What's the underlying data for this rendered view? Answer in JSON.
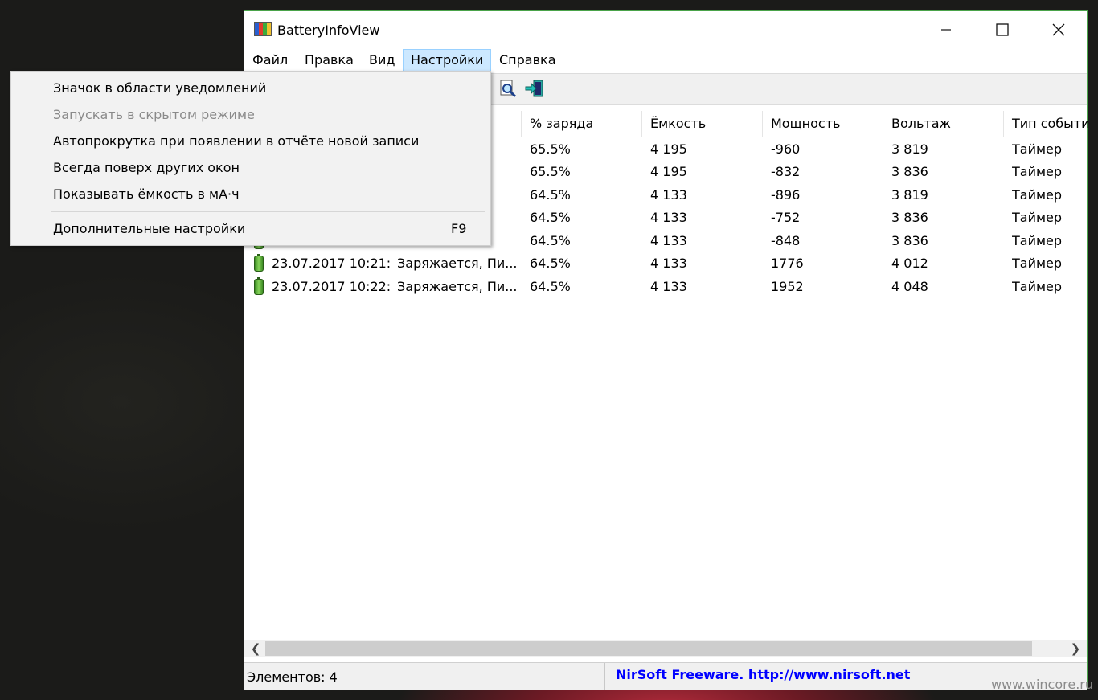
{
  "window": {
    "title": "BatteryInfoView"
  },
  "menubar": [
    "Файл",
    "Правка",
    "Вид",
    "Настройки",
    "Справка"
  ],
  "columns": [
    "",
    "",
    "% заряда",
    "Ёмкость",
    "Мощность",
    "Вольтаж",
    "Тип событи"
  ],
  "rows": [
    [
      "",
      "",
      "65.5%",
      "4 195",
      "-960",
      "3 819",
      "Таймер"
    ],
    [
      "",
      "",
      "65.5%",
      "4 195",
      "-832",
      "3 836",
      "Таймер"
    ],
    [
      "",
      "",
      "64.5%",
      "4 133",
      "-896",
      "3 819",
      "Таймер"
    ],
    [
      "",
      "",
      "64.5%",
      "4 133",
      "-752",
      "3 836",
      "Таймер"
    ],
    [
      "",
      "",
      "64.5%",
      "4 133",
      "-848",
      "3 836",
      "Таймер"
    ],
    [
      "23.07.2017 10:21:...",
      "Заряжается, Пи...",
      "64.5%",
      "4 133",
      "1776",
      "4 012",
      "Таймер"
    ],
    [
      "23.07.2017 10:22:...",
      "Заряжается, Пи...",
      "64.5%",
      "4 133",
      "1952",
      "4 048",
      "Таймер"
    ]
  ],
  "statusbar": {
    "count": "Элементов: 4",
    "link": "NirSoft Freeware.  http://www.nirsoft.net"
  },
  "dropdown": {
    "items": [
      {
        "label": "Значок в области уведомлений",
        "accel": "",
        "disabled": false
      },
      {
        "label": "Запускать в скрытом режиме",
        "accel": "",
        "disabled": true
      },
      {
        "label": "Автопрокрутка при появлении в отчёте новой записи",
        "accel": "",
        "disabled": false
      },
      {
        "label": "Всегда поверх других окон",
        "accel": "",
        "disabled": false
      },
      {
        "label": "Показывать ёмкость в мА·ч",
        "accel": "",
        "disabled": false
      },
      {
        "label": "Дополнительные настройки",
        "accel": "F9",
        "disabled": false
      }
    ]
  },
  "watermark": "www.wincore.ru",
  "icons": [
    "app-battery-icon",
    "find-icon",
    "exit-icon",
    "battery-icon",
    "minimize-icon",
    "maximize-icon",
    "close-icon"
  ]
}
